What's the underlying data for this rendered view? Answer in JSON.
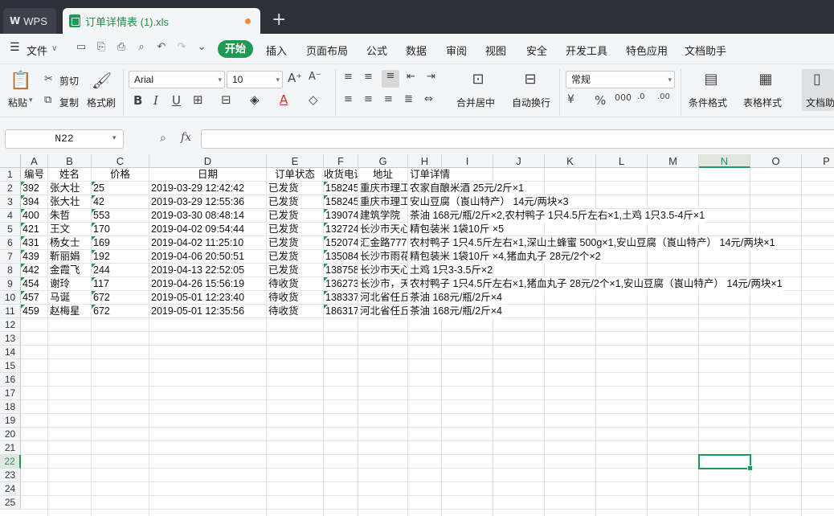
{
  "tabs": {
    "wps": "WPS",
    "doc": "订单详情表 (1).xls"
  },
  "menu": {
    "file": "文件",
    "items": [
      "开始",
      "插入",
      "页面布局",
      "公式",
      "数据",
      "审阅",
      "视图",
      "安全",
      "开发工具",
      "特色应用",
      "文档助手"
    ]
  },
  "ribbon": {
    "paste": "粘贴",
    "cut": "剪切",
    "copy": "复制",
    "format_painter": "格式刷",
    "font_name": "Arial",
    "font_size": "10",
    "merge_center": "合并居中",
    "wrap_text": "自动换行",
    "number_format": "常规",
    "conditional_format": "条件格式",
    "table_style": "表格样式",
    "doc_assist": "文档助"
  },
  "formula_bar": {
    "name_box": "N22",
    "fx": "fx",
    "value": ""
  },
  "accent_color": "#1e9a54",
  "columns": [
    "A",
    "B",
    "C",
    "D",
    "E",
    "F",
    "G",
    "H",
    "I",
    "J",
    "K",
    "L",
    "M",
    "N",
    "O",
    "P"
  ],
  "row_numbers": [
    "1",
    "2",
    "3",
    "4",
    "5",
    "6",
    "7",
    "8",
    "9",
    "10",
    "11",
    "12",
    "13",
    "14",
    "15",
    "16",
    "17",
    "18",
    "19",
    "20",
    "21",
    "22",
    "23",
    "24",
    "25"
  ],
  "headers": [
    "编号",
    "姓名",
    "价格",
    "日期",
    "订单状态",
    "收货电话",
    "地址",
    "订单详情"
  ],
  "rows": [
    [
      "392",
      "张大壮",
      "25",
      "2019-03-29 12:42:42",
      "已发货",
      "158245",
      "重庆市理工",
      "农家自酿米酒  25元/2斤×1"
    ],
    [
      "394",
      "张大壮",
      "42",
      "2019-03-29 12:55:36",
      "已发货",
      "158245",
      "重庆市理工",
      "安山豆腐（崀山特产） 14元/两块×3"
    ],
    [
      "400",
      "朱哲",
      "553",
      "2019-03-30 08:48:14",
      "已发货",
      "139074",
      "建筑学院",
      "茶油  168元/瓶/2斤×2,农村鸭子 1只4.5斤左右×1,土鸡 1只3.5-4斤×1"
    ],
    [
      "421",
      "王文",
      "170",
      "2019-04-02 09:54:44",
      "已发货",
      "132724",
      "长沙市天心",
      "精包装米 1袋10斤 ×5"
    ],
    [
      "431",
      "杨女士",
      "169",
      "2019-04-02 11:25:10",
      "已发货",
      "152074",
      "汇金路777",
      "农村鸭子 1只4.5斤左右×1,深山土蜂蜜 500g×1,安山豆腐（崀山特产） 14元/两块×1"
    ],
    [
      "439",
      "靳丽娟",
      "192",
      "2019-04-06 20:50:51",
      "已发货",
      "135084",
      "长沙市雨花",
      "精包装米 1袋10斤 ×4,猪血丸子 28元/2个×2"
    ],
    [
      "442",
      "金霞飞",
      "244",
      "2019-04-13 22:52:05",
      "已发货",
      "138758",
      "长沙市天心",
      "土鸡 1只3-3.5斤×2"
    ],
    [
      "454",
      "谢玲",
      "117",
      "2019-04-26 15:56:19",
      "待收货",
      "136273",
      "长沙市，天",
      "农村鸭子 1只4.5斤左右×1,猪血丸子 28元/2个×1,安山豆腐（崀山特产） 14元/两块×1"
    ],
    [
      "457",
      "马诞",
      "672",
      "2019-05-01 12:23:40",
      "待收货",
      "138337",
      "河北省任丘",
      "茶油  168元/瓶/2斤×4"
    ],
    [
      "459",
      "赵梅星",
      "672",
      "2019-05-01 12:35:56",
      "待收货",
      "186317",
      "河北省任丘",
      "茶油  168元/瓶/2斤×4"
    ]
  ]
}
